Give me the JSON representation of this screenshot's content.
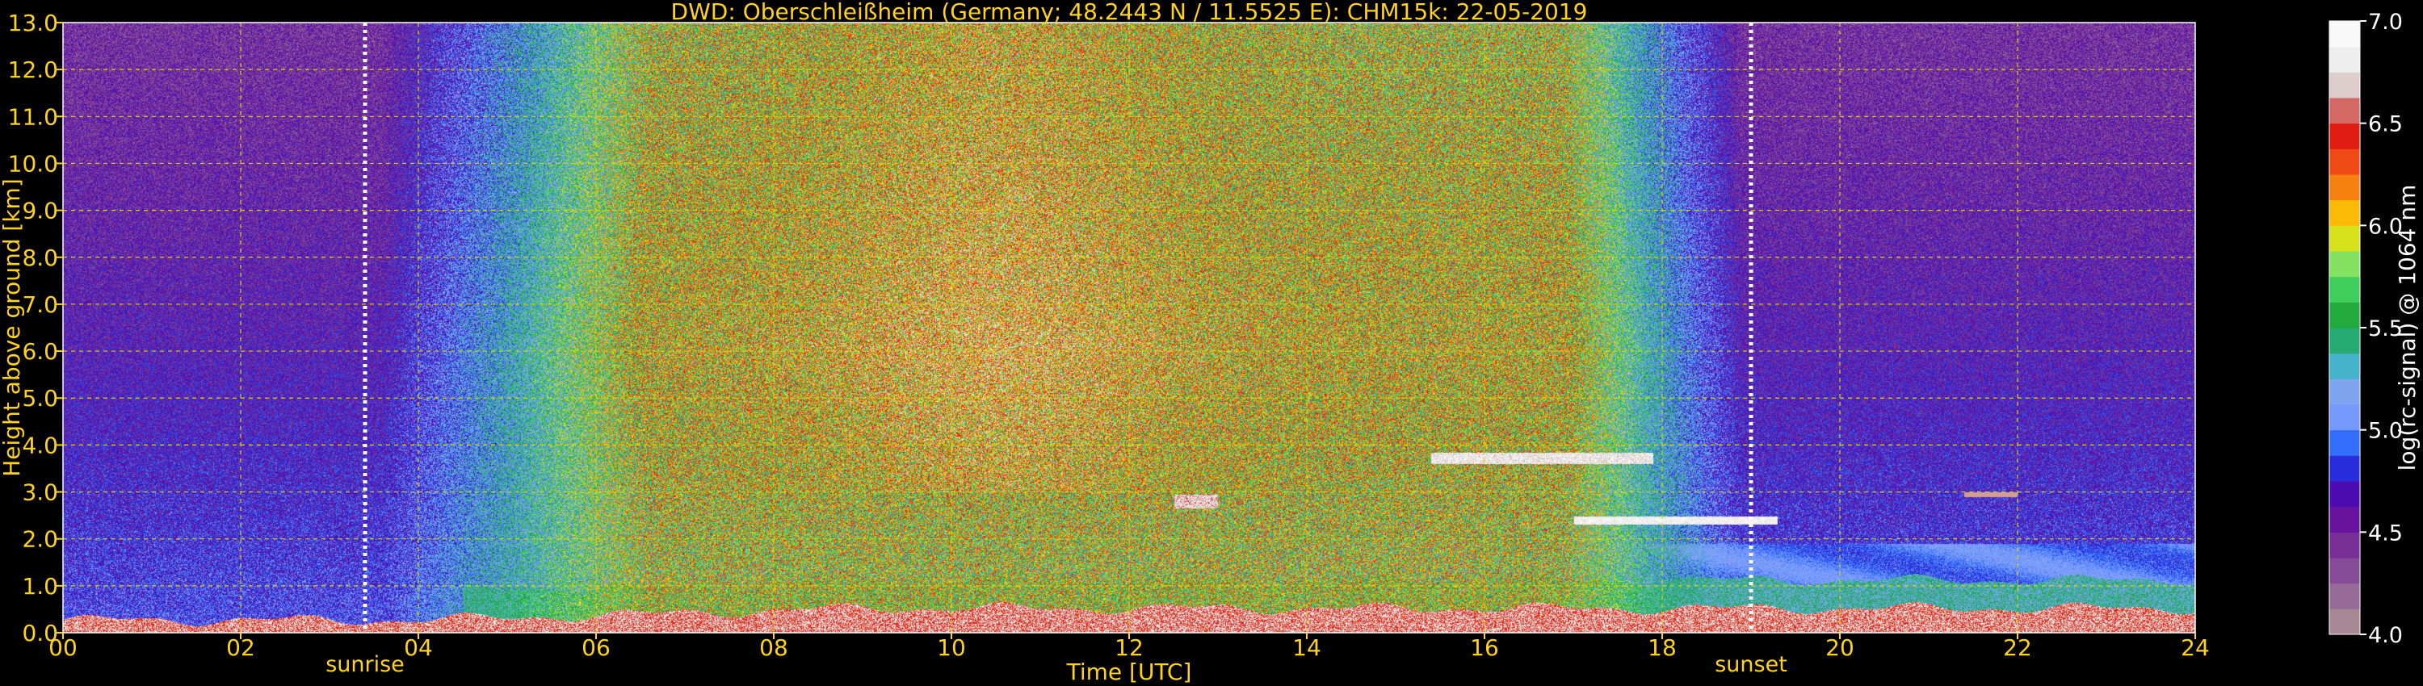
{
  "chart_data": {
    "type": "heatmap",
    "title": "DWD: Oberschleißheim (Germany; 48.2443 N / 11.5525 E):    CHM15k: 22-05-2019",
    "xlabel": "Time [UTC]",
    "ylabel": "Height above ground [km]",
    "xlim": [
      0,
      24
    ],
    "ylim": [
      0,
      13
    ],
    "x_ticks": [
      "00",
      "02",
      "04",
      "06",
      "08",
      "10",
      "12",
      "14",
      "16",
      "18",
      "20",
      "22",
      "24"
    ],
    "y_ticks": [
      "0.0",
      "1.0",
      "2.0",
      "3.0",
      "4.0",
      "5.0",
      "6.0",
      "7.0",
      "8.0",
      "9.0",
      "10.0",
      "11.0",
      "12.0",
      "13.0"
    ],
    "grid": true,
    "colorbar": {
      "label": "log(rc-signal) @ 1064 nm",
      "range": [
        4.0,
        7.0
      ],
      "ticks": [
        "4.0",
        "4.5",
        "5.0",
        "5.5",
        "6.0",
        "6.5",
        "7.0"
      ]
    },
    "annotations": [
      {
        "label": "sunrise",
        "time": 3.4
      },
      {
        "label": "sunset",
        "time": 19.0
      }
    ]
  },
  "colors": {
    "background": "#000000",
    "text": "#ffd21e",
    "grid": "#d8d800",
    "colorbar_text": "#ffffff"
  }
}
